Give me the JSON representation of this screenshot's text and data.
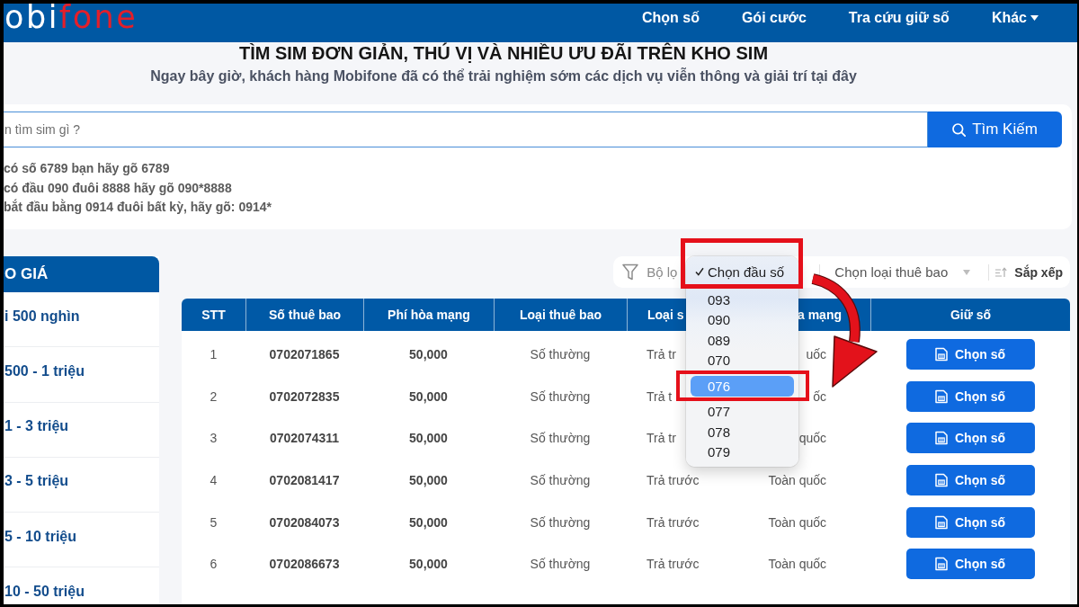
{
  "header": {
    "logo": {
      "lead": "obi",
      "accent": "fone"
    },
    "nav": [
      {
        "label": "Chọn số",
        "kind": "link"
      },
      {
        "label": "Gói cước",
        "kind": "link"
      },
      {
        "label": "Tra cứu giữ số",
        "kind": "link"
      },
      {
        "label": "Khác",
        "kind": "menu"
      }
    ]
  },
  "hero": {
    "title": "TÌM SIM ĐƠN GIẢN, THÚ VỊ VÀ NHIỀU ƯU ĐÃI TRÊN KHO SIM",
    "subtitle": "Ngay bây giờ, khách hàng Mobifone đã có thể trải nghiệm sớm các dịch vụ viễn thông và giải trí tại đây"
  },
  "search": {
    "placeholder": "n tìm sim gì ?",
    "button": "Tìm Kiếm",
    "hints": [
      "có số 6789 bạn hãy gõ 6789",
      "có đầu 090 đuôi 8888 hãy gõ 090*8888",
      "bắt đầu bằng 0914 đuôi bất kỳ, hãy gõ: 0914*"
    ]
  },
  "price_filter": {
    "title": "O GIÁ",
    "items": [
      "i 500 nghìn",
      "500 - 1 triệu",
      "1 - 3 triệu",
      "3 - 5 triệu",
      "5 - 10 triệu",
      "10 - 50 triệu"
    ]
  },
  "filters": {
    "filter_label": "Bộ lọ",
    "subscriber_type": "Chọn loại thuê bao",
    "sort": "Sắp xếp"
  },
  "table": {
    "columns": [
      "STT",
      "Số thuê bao",
      "Phí hòa mạng",
      "Loại thuê bao",
      "Loại s",
      "a mạng",
      "Giữ số"
    ],
    "rows": [
      {
        "cells": [
          "1",
          "0702071865",
          "50,000",
          "Số thường",
          "Trả tr",
          "uốc"
        ],
        "action": "Chọn số"
      },
      {
        "cells": [
          "2",
          "0702072835",
          "50,000",
          "Số thường",
          "Trả t",
          "ốc"
        ],
        "action": "Chọn số"
      },
      {
        "cells": [
          "3",
          "0702074311",
          "50,000",
          "Số thường",
          "Trả tr",
          "quốc"
        ],
        "action": "Chọn số"
      },
      {
        "cells": [
          "4",
          "0702081417",
          "50,000",
          "Số thường",
          "Trả trước",
          "Toàn quốc"
        ],
        "action": "Chọn số"
      },
      {
        "cells": [
          "5",
          "0702084073",
          "50,000",
          "Số thường",
          "Trả trước",
          "Toàn quốc"
        ],
        "action": "Chọn số"
      },
      {
        "cells": [
          "6",
          "0702086673",
          "50,000",
          "Số thường",
          "Trả trước",
          "Toàn quốc"
        ],
        "action": "Chọn số"
      }
    ]
  },
  "prefix_dropdown": {
    "options": [
      {
        "label": "Chọn đầu số",
        "checked": true,
        "selected": false
      },
      {
        "label": "093",
        "checked": false,
        "selected": false
      },
      {
        "label": "090",
        "checked": false,
        "selected": false
      },
      {
        "label": "089",
        "checked": false,
        "selected": false
      },
      {
        "label": "070",
        "checked": false,
        "selected": false
      },
      {
        "label": "076",
        "checked": false,
        "selected": true
      },
      {
        "label": "077",
        "checked": false,
        "selected": false
      },
      {
        "label": "078",
        "checked": false,
        "selected": false
      },
      {
        "label": "079",
        "checked": false,
        "selected": false
      }
    ]
  }
}
